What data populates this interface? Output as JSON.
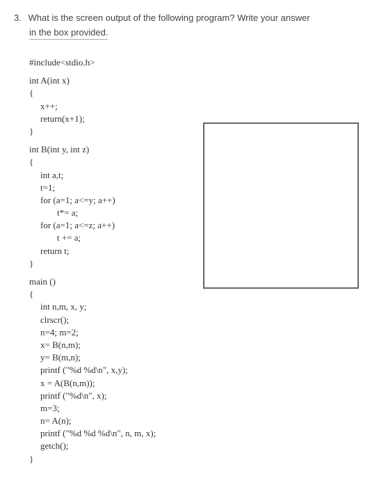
{
  "question": {
    "number": "3.",
    "text": "What is the screen output of the following program? Write your answer",
    "sub": "in the box provided."
  },
  "code": {
    "l1": "#include<stdio.h>",
    "l2": "int A(int x)",
    "l3": "{",
    "l4": "x++;",
    "l5": "return(x+1);",
    "l6": "}",
    "l7": "int B(int y, int z)",
    "l8": "{",
    "l9": "int a,t;",
    "l10": "t=1;",
    "l11": "for (a=1; a<=y; a++)",
    "l12": "t*= a;",
    "l13": "for (a=1; a<=z; a++)",
    "l14": "t += a;",
    "l15": "return t;",
    "l16": "}",
    "l17": "main ()",
    "l18": "{",
    "l19": "int n,m, x, y;",
    "l20": "clrscr();",
    "l21": "n=4; m=2;",
    "l22": "x= B(n,m);",
    "l23": "y= B(m,n);",
    "l24": "printf (\"%d %d\\n\", x,y);",
    "l25": "x = A(B(n,m));",
    "l26": "printf (\"%d\\n\", x);",
    "l27": "m=3;",
    "l28": "n= A(n);",
    "l29": "printf (\"%d %d %d\\n\", n, m, x);",
    "l30": "getch();",
    "l31": "}"
  }
}
